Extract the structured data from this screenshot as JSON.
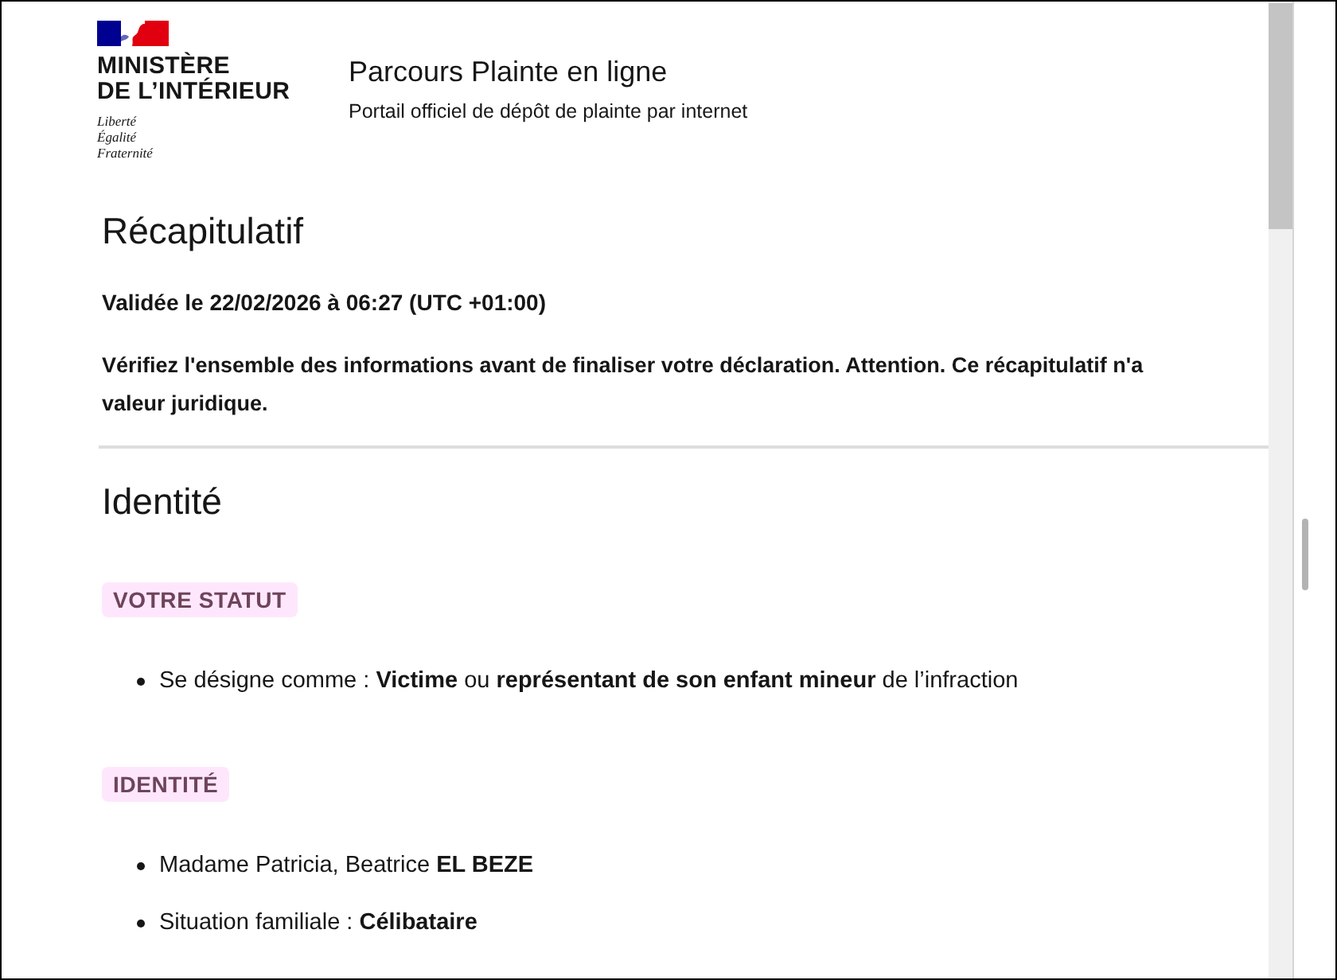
{
  "header": {
    "logo": {
      "name_lines": [
        "MINISTÈRE",
        "DE L’INTÉRIEUR"
      ],
      "motto": [
        "Liberté",
        "Égalité",
        "Fraternité"
      ]
    },
    "service": {
      "title": "Parcours Plainte en ligne",
      "tagline": "Portail officiel de dépôt de plainte par internet"
    }
  },
  "summary": {
    "title": "Récapitulatif",
    "validated": "Validée le 22/02/2026 à 06:27 (UTC +01:00)",
    "notice_lines": [
      "Vérifiez l'ensemble des informations avant de finaliser votre déclaration. Attention. Ce récapitulatif n'a",
      "valeur juridique."
    ]
  },
  "sections": [
    {
      "title": "Identité",
      "groups": [
        {
          "tag": "VOTRE STATUT",
          "items": [
            "Se désigne comme : **Victime** ou **représentant de son enfant mineur** de l’infraction"
          ]
        },
        {
          "tag": "IDENTITÉ",
          "items": [
            "Madame Patricia, Beatrice **EL BEZE**",
            "Situation familiale : **Célibataire**"
          ]
        }
      ]
    }
  ]
}
